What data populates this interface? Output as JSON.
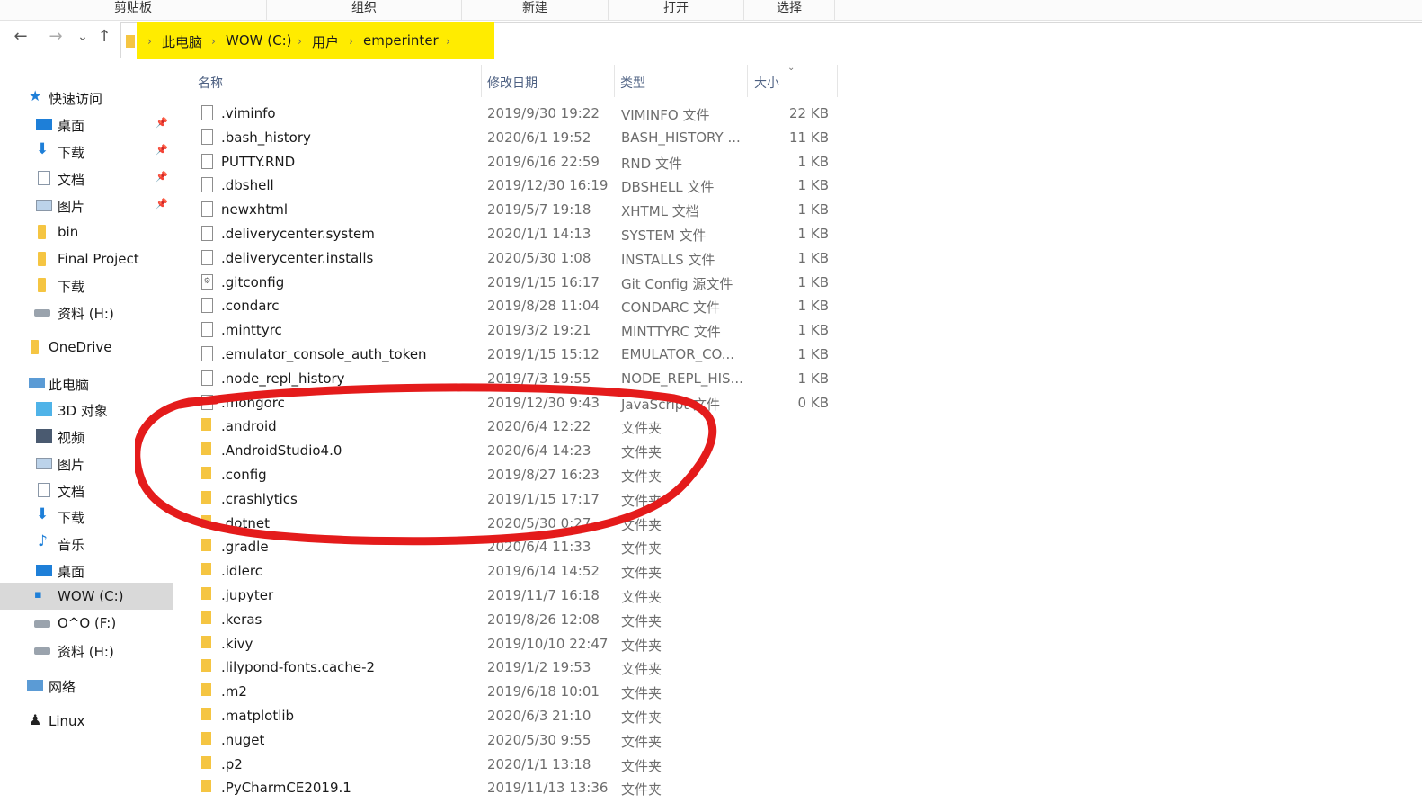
{
  "ribbon": {
    "groups": [
      "剪贴板",
      "组织",
      "新建",
      "打开",
      "选择"
    ]
  },
  "nav": {
    "back": "←",
    "forward": "→",
    "recent": "⌄",
    "up": "↑"
  },
  "breadcrumb": [
    "此电脑",
    "WOW (C:)",
    "用户",
    "emperinter"
  ],
  "sidebar": {
    "items": [
      {
        "label": "快速访问"
      },
      {
        "label": "桌面"
      },
      {
        "label": "下载"
      },
      {
        "label": "文档"
      },
      {
        "label": "图片"
      },
      {
        "label": "bin"
      },
      {
        "label": "Final Project"
      },
      {
        "label": "下载"
      },
      {
        "label": "资料 (H:)"
      },
      {
        "label": "OneDrive"
      },
      {
        "label": "此电脑"
      },
      {
        "label": "3D 对象"
      },
      {
        "label": "视频"
      },
      {
        "label": "图片"
      },
      {
        "label": "文档"
      },
      {
        "label": "下载"
      },
      {
        "label": "音乐"
      },
      {
        "label": "桌面"
      },
      {
        "label": "WOW (C:)"
      },
      {
        "label": "O^O (F:)"
      },
      {
        "label": "资料 (H:)"
      },
      {
        "label": "网络"
      },
      {
        "label": "Linux"
      }
    ]
  },
  "columns": {
    "name": "名称",
    "date": "修改日期",
    "type": "类型",
    "size": "大小"
  },
  "files": [
    {
      "name": ".viminfo",
      "date": "2019/9/30 19:22",
      "type": "VIMINFO 文件",
      "size": "22 KB",
      "kind": "file"
    },
    {
      "name": ".bash_history",
      "date": "2020/6/1 19:52",
      "type": "BASH_HISTORY ...",
      "size": "11 KB",
      "kind": "file"
    },
    {
      "name": "PUTTY.RND",
      "date": "2019/6/16 22:59",
      "type": "RND 文件",
      "size": "1 KB",
      "kind": "file"
    },
    {
      "name": ".dbshell",
      "date": "2019/12/30 16:19",
      "type": "DBSHELL 文件",
      "size": "1 KB",
      "kind": "file"
    },
    {
      "name": "newxhtml",
      "date": "2019/5/7 19:18",
      "type": "XHTML 文档",
      "size": "1 KB",
      "kind": "file"
    },
    {
      "name": ".deliverycenter.system",
      "date": "2020/1/1 14:13",
      "type": "SYSTEM 文件",
      "size": "1 KB",
      "kind": "file"
    },
    {
      "name": ".deliverycenter.installs",
      "date": "2020/5/30 1:08",
      "type": "INSTALLS 文件",
      "size": "1 KB",
      "kind": "file"
    },
    {
      "name": ".gitconfig",
      "date": "2019/1/15 16:17",
      "type": "Git Config 源文件",
      "size": "1 KB",
      "kind": "gear"
    },
    {
      "name": ".condarc",
      "date": "2019/8/28 11:04",
      "type": "CONDARC 文件",
      "size": "1 KB",
      "kind": "file"
    },
    {
      "name": ".minttyrc",
      "date": "2019/3/2 19:21",
      "type": "MINTTYRC 文件",
      "size": "1 KB",
      "kind": "file"
    },
    {
      "name": ".emulator_console_auth_token",
      "date": "2019/1/15 15:12",
      "type": "EMULATOR_CO...",
      "size": "1 KB",
      "kind": "file"
    },
    {
      "name": ".node_repl_history",
      "date": "2019/7/3 19:55",
      "type": "NODE_REPL_HIS...",
      "size": "1 KB",
      "kind": "file"
    },
    {
      "name": ".mongorc",
      "date": "2019/12/30 9:43",
      "type": "JavaScript 文件",
      "size": "0 KB",
      "kind": "file"
    },
    {
      "name": ".android",
      "date": "2020/6/4 12:22",
      "type": "文件夹",
      "size": "",
      "kind": "folder"
    },
    {
      "name": ".AndroidStudio4.0",
      "date": "2020/6/4 14:23",
      "type": "文件夹",
      "size": "",
      "kind": "folder"
    },
    {
      "name": ".config",
      "date": "2019/8/27 16:23",
      "type": "文件夹",
      "size": "",
      "kind": "folder"
    },
    {
      "name": ".crashlytics",
      "date": "2019/1/15 17:17",
      "type": "文件夹",
      "size": "",
      "kind": "folder"
    },
    {
      "name": ".dotnet",
      "date": "2020/5/30 0:27",
      "type": "文件夹",
      "size": "",
      "kind": "folder"
    },
    {
      "name": ".gradle",
      "date": "2020/6/4 11:33",
      "type": "文件夹",
      "size": "",
      "kind": "folder"
    },
    {
      "name": ".idlerc",
      "date": "2019/6/14 14:52",
      "type": "文件夹",
      "size": "",
      "kind": "folder"
    },
    {
      "name": ".jupyter",
      "date": "2019/11/7 16:18",
      "type": "文件夹",
      "size": "",
      "kind": "folder"
    },
    {
      "name": ".keras",
      "date": "2019/8/26 12:08",
      "type": "文件夹",
      "size": "",
      "kind": "folder"
    },
    {
      "name": ".kivy",
      "date": "2019/10/10 22:47",
      "type": "文件夹",
      "size": "",
      "kind": "folder"
    },
    {
      "name": ".lilypond-fonts.cache-2",
      "date": "2019/1/2 19:53",
      "type": "文件夹",
      "size": "",
      "kind": "folder"
    },
    {
      "name": ".m2",
      "date": "2019/6/18 10:01",
      "type": "文件夹",
      "size": "",
      "kind": "folder"
    },
    {
      "name": ".matplotlib",
      "date": "2020/6/3 21:10",
      "type": "文件夹",
      "size": "",
      "kind": "folder"
    },
    {
      "name": ".nuget",
      "date": "2020/5/30 9:55",
      "type": "文件夹",
      "size": "",
      "kind": "folder"
    },
    {
      "name": ".p2",
      "date": "2020/1/1 13:18",
      "type": "文件夹",
      "size": "",
      "kind": "folder"
    },
    {
      "name": ".PyCharmCE2019.1",
      "date": "2019/11/13 13:36",
      "type": "文件夹",
      "size": "",
      "kind": "folder"
    }
  ],
  "colors": {
    "breadcrumb_highlight": "#ffec00",
    "annotation_red": "#e41b1b",
    "folder": "#f5c542",
    "selected_nav": "#d9d9d9"
  }
}
